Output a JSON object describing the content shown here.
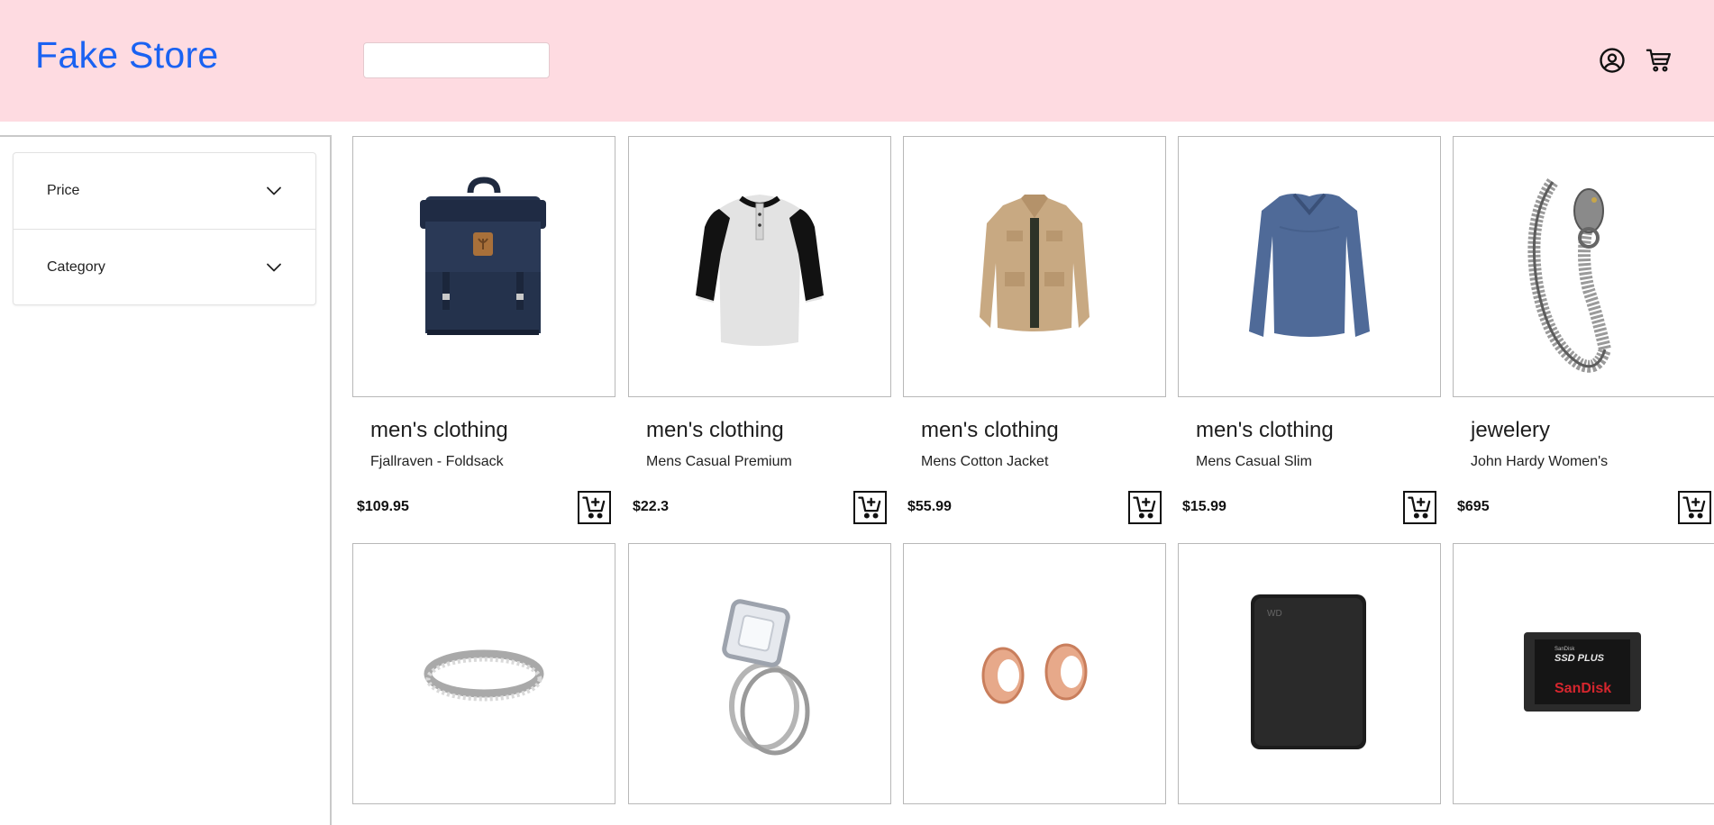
{
  "header": {
    "logo": "Fake Store",
    "search_placeholder": "",
    "account_icon": "user-circle-icon",
    "cart_icon": "shopping-cart-icon"
  },
  "sidebar": {
    "filters": [
      {
        "label": "Price",
        "icon": "chevron-down-icon"
      },
      {
        "label": "Category",
        "icon": "chevron-down-icon"
      }
    ]
  },
  "products": [
    {
      "category": "men's clothing",
      "title": "Fjallraven - Foldsack",
      "price": "$109.95",
      "image": "backpack"
    },
    {
      "category": "men's clothing",
      "title": "Mens Casual Premium",
      "price": "$22.3",
      "image": "raglan-tee"
    },
    {
      "category": "men's clothing",
      "title": "Mens Cotton Jacket",
      "price": "$55.99",
      "image": "jacket"
    },
    {
      "category": "men's clothing",
      "title": "Mens Casual Slim",
      "price": "$15.99",
      "image": "long-sleeve-shirt"
    },
    {
      "category": "jewelery",
      "title": "John Hardy Women's",
      "price": "$695",
      "image": "dragon-bracelet"
    },
    {
      "category": "",
      "title": "",
      "price": "",
      "image": "silver-band-ring"
    },
    {
      "category": "",
      "title": "",
      "price": "",
      "image": "diamond-ring-set"
    },
    {
      "category": "",
      "title": "",
      "price": "",
      "image": "rose-gold-plugs"
    },
    {
      "category": "",
      "title": "",
      "price": "",
      "image": "external-hard-drive"
    },
    {
      "category": "",
      "title": "",
      "price": "",
      "image": "sandisk-ssd"
    }
  ],
  "product_images_text": {
    "ssd_line1": "SanDisk",
    "ssd_line2": "SSD PLUS",
    "ssd_brand": "SanDisk",
    "drive_brand": "WD"
  },
  "add_to_cart_icon": "add-to-cart-icon",
  "colors": {
    "header_bg": "#fedbe1",
    "logo": "#1a62f2"
  }
}
